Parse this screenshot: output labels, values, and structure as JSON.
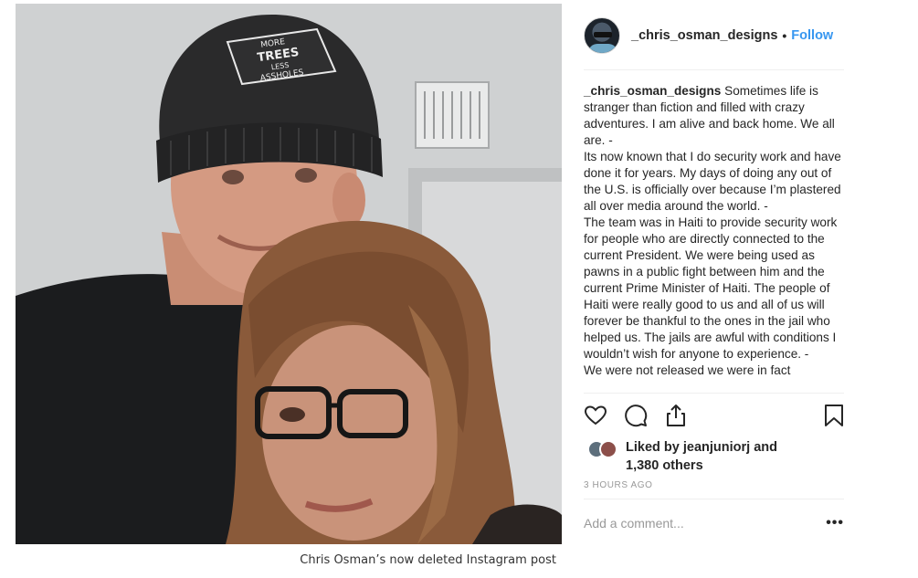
{
  "post": {
    "username": "_chris_osman_designs",
    "separator": "•",
    "follow_label": "Follow",
    "caption_username": "_chris_osman_designs",
    "caption_body": " Sometimes life is stranger than fiction and filled with crazy adventures. I am alive and back home. We all are. -\nIts now known that I do security work and have done it for years. My days of doing any out of the U.S. is officially over because I’m plastered all over media around the world. -\nThe team was in Haiti to provide security work for people who are directly connected to the current President. We were being used as pawns in a public fight between him and the current Prime Minister of Haiti. The people of Haiti were really good to us and all of us will forever be thankful to the ones in the jail who helped us. The jails are awful with conditions I wouldn’t wish for anyone to experience. -\nWe were not released we were in fact",
    "likes": {
      "prefix": "Liked by ",
      "user": "jeanjuniorj",
      "middle": " and",
      "others": "1,380 others"
    },
    "timestamp": "3 HOURS AGO",
    "comment_placeholder": "Add a comment...",
    "more_label": "•••"
  },
  "photo": {
    "beanie_text": [
      "MORE",
      "TREES",
      "LESS",
      "ASSHOLES"
    ]
  },
  "caption": "Chris Osman’s now deleted Instagram post",
  "icons": [
    "heart-icon",
    "comment-icon",
    "share-icon",
    "bookmark-icon"
  ],
  "colors": {
    "follow": "#3897f0",
    "text": "#262626",
    "muted": "#999999",
    "divider": "#efefef"
  }
}
